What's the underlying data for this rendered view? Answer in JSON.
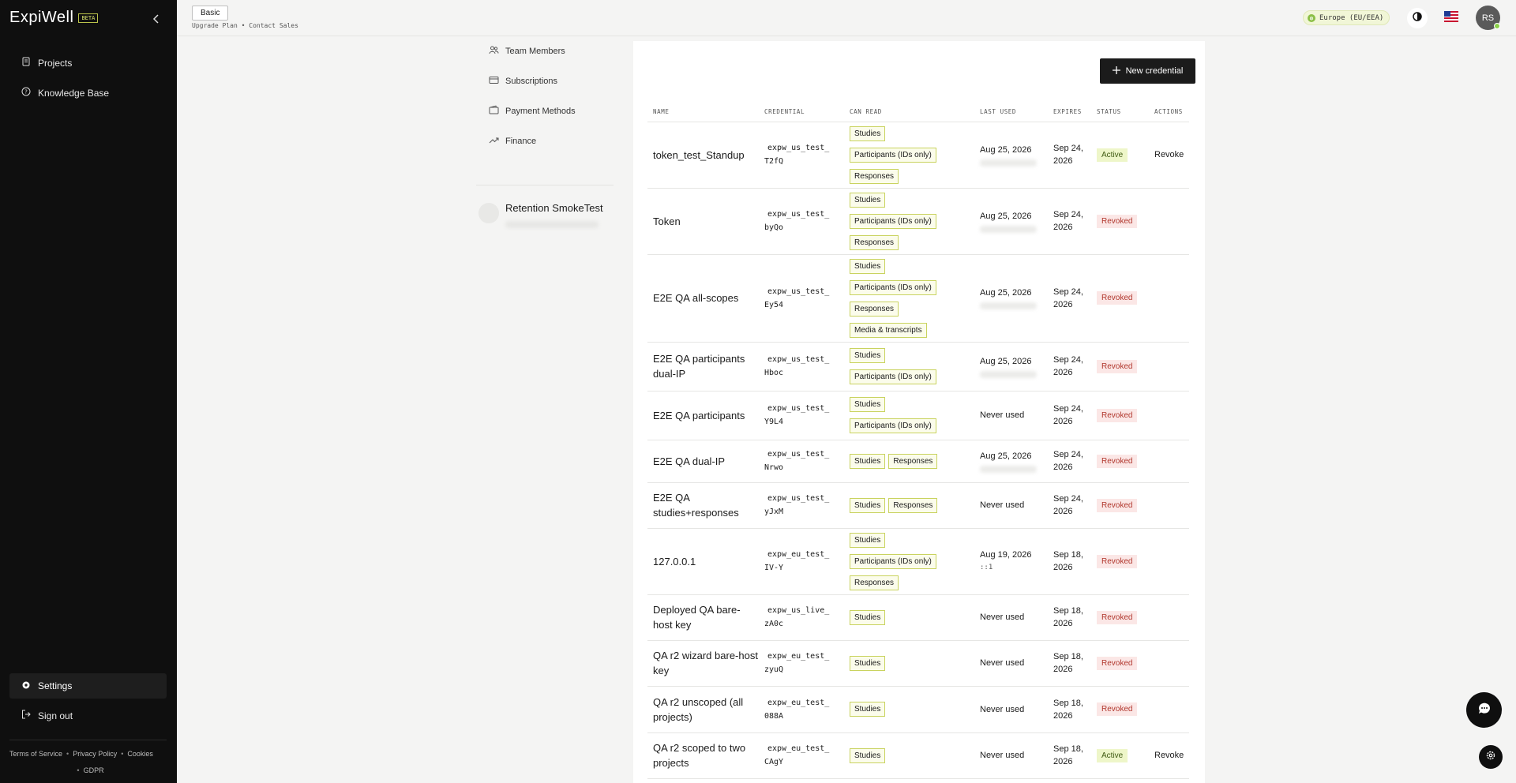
{
  "brand": {
    "name": "ExpiWell",
    "badge": "BETA"
  },
  "sidebar": {
    "items": [
      {
        "label": "Projects",
        "icon": "file-icon"
      },
      {
        "label": "Knowledge Base",
        "icon": "help-circle-icon"
      }
    ],
    "settings_label": "Settings",
    "signout_label": "Sign out",
    "footer": {
      "terms": "Terms of Service",
      "privacy": "Privacy Policy",
      "cookies": "Cookies",
      "gdpr": "GDPR"
    }
  },
  "topbar": {
    "plan": "Basic",
    "upgrade": "Upgrade Plan",
    "sep": "•",
    "contact": "Contact Sales",
    "region": "Europe (EU/EEA)",
    "avatar": "RS"
  },
  "subnav": {
    "items": [
      {
        "label": "Team Members",
        "icon": "users-icon"
      },
      {
        "label": "Subscriptions",
        "icon": "card-icon"
      },
      {
        "label": "Payment Methods",
        "icon": "wallet-icon"
      },
      {
        "label": "Finance",
        "icon": "trend-icon"
      }
    ],
    "project": {
      "name": "Retention SmokeTest"
    }
  },
  "credentials": {
    "new_button": "New credential",
    "columns": [
      "NAME",
      "CREDENTIAL",
      "CAN READ",
      "LAST USED",
      "EXPIRES",
      "STATUS",
      "ACTIONS"
    ],
    "rows": [
      {
        "name": "token_test_Standup",
        "cred_prefix": "expw_us_test_",
        "cred_suffix": "T2fQ",
        "scopes": [
          "Studies",
          "Participants (IDs only)",
          "Responses"
        ],
        "last_used": "Aug 25, 2026",
        "ip": "",
        "ip_blurred": true,
        "expires": "Sep 24, 2026",
        "status": "Active",
        "action": "Revoke"
      },
      {
        "name": "Token",
        "cred_prefix": "expw_us_test_",
        "cred_suffix": "byQo",
        "scopes": [
          "Studies",
          "Participants (IDs only)",
          "Responses"
        ],
        "last_used": "Aug 25, 2026",
        "ip": "",
        "ip_blurred": true,
        "expires": "Sep 24, 2026",
        "status": "Revoked",
        "action": ""
      },
      {
        "name": "E2E QA all-scopes",
        "cred_prefix": "expw_us_test_",
        "cred_suffix": "Ey54",
        "scopes": [
          "Studies",
          "Participants (IDs only)",
          "Responses",
          "Media & transcripts"
        ],
        "last_used": "Aug 25, 2026",
        "ip": "",
        "ip_blurred": true,
        "expires": "Sep 24, 2026",
        "status": "Revoked",
        "action": ""
      },
      {
        "name": "E2E QA participants dual-IP",
        "cred_prefix": "expw_us_test_",
        "cred_suffix": "Hboc",
        "scopes": [
          "Studies",
          "Participants (IDs only)"
        ],
        "last_used": "Aug 25, 2026",
        "ip": "",
        "ip_blurred": true,
        "expires": "Sep 24, 2026",
        "status": "Revoked",
        "action": ""
      },
      {
        "name": "E2E QA participants",
        "cred_prefix": "expw_us_test_",
        "cred_suffix": "Y9L4",
        "scopes": [
          "Studies",
          "Participants (IDs only)"
        ],
        "last_used": "Never used",
        "ip": "",
        "ip_blurred": false,
        "expires": "Sep 24, 2026",
        "status": "Revoked",
        "action": ""
      },
      {
        "name": "E2E QA dual-IP",
        "cred_prefix": "expw_us_test_",
        "cred_suffix": "Nrwo",
        "scopes": [
          "Studies",
          "Responses"
        ],
        "last_used": "Aug 25, 2026",
        "ip": "",
        "ip_blurred": true,
        "expires": "Sep 24, 2026",
        "status": "Revoked",
        "action": ""
      },
      {
        "name": "E2E QA studies+responses",
        "cred_prefix": "expw_us_test_",
        "cred_suffix": "yJxM",
        "scopes": [
          "Studies",
          "Responses"
        ],
        "last_used": "Never used",
        "ip": "",
        "ip_blurred": false,
        "expires": "Sep 24, 2026",
        "status": "Revoked",
        "action": ""
      },
      {
        "name": "127.0.0.1",
        "cred_prefix": "expw_eu_test_",
        "cred_suffix": "IV-Y",
        "scopes": [
          "Studies",
          "Participants (IDs only)",
          "Responses"
        ],
        "last_used": "Aug 19, 2026",
        "ip": "::1",
        "ip_blurred": false,
        "expires": "Sep 18, 2026",
        "status": "Revoked",
        "action": ""
      },
      {
        "name": "Deployed QA bare-host key",
        "cred_prefix": "expw_us_live_",
        "cred_suffix": "zA0c",
        "scopes": [
          "Studies"
        ],
        "last_used": "Never used",
        "ip": "",
        "ip_blurred": false,
        "expires": "Sep 18, 2026",
        "status": "Revoked",
        "action": ""
      },
      {
        "name": "QA r2 wizard bare-host key",
        "cred_prefix": "expw_eu_test_",
        "cred_suffix": "zyuQ",
        "scopes": [
          "Studies"
        ],
        "last_used": "Never used",
        "ip": "",
        "ip_blurred": false,
        "expires": "Sep 18, 2026",
        "status": "Revoked",
        "action": ""
      },
      {
        "name": "QA r2 unscoped (all projects)",
        "cred_prefix": "expw_eu_test_",
        "cred_suffix": "088A",
        "scopes": [
          "Studies"
        ],
        "last_used": "Never used",
        "ip": "",
        "ip_blurred": false,
        "expires": "Sep 18, 2026",
        "status": "Revoked",
        "action": ""
      },
      {
        "name": "QA r2 scoped to two projects",
        "cred_prefix": "expw_eu_test_",
        "cred_suffix": "CAgY",
        "scopes": [
          "Studies"
        ],
        "last_used": "Never used",
        "ip": "",
        "ip_blurred": false,
        "expires": "Sep 18, 2026",
        "status": "Active",
        "action": "Revoke"
      }
    ]
  },
  "colors": {
    "sidebar_bg": "#0f0f0f",
    "scope_border": "#c9d35f",
    "active_bg": "#eef6c9",
    "revoked_fg": "#b0352b"
  }
}
